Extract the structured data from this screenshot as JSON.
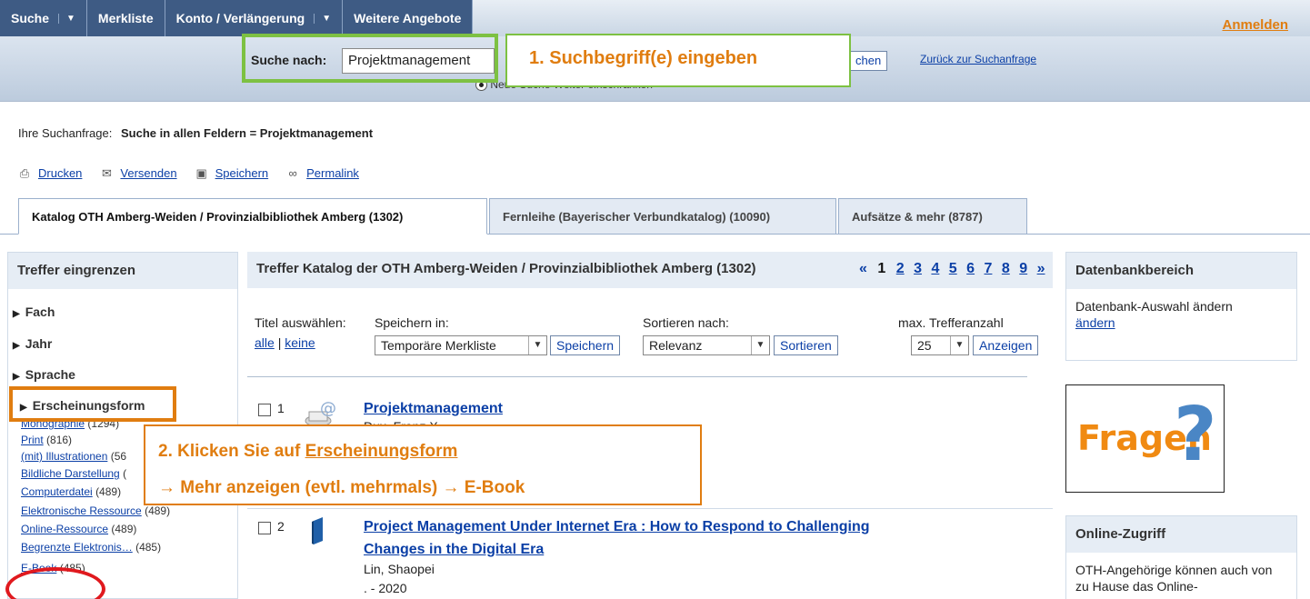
{
  "nav": {
    "items": [
      "Suche",
      "Merkliste",
      "Konto / Verlängerung",
      "Weitere Angebote"
    ],
    "login": "Anmelden"
  },
  "search": {
    "label": "Suche nach:",
    "value": "Projektmanagement",
    "button": "chen",
    "back_link": "Zurück zur Suchanfrage",
    "radio_label": "Neue Suche  Weiter einschränken"
  },
  "callout1": "1. Suchbegriff(e) eingeben",
  "query": {
    "label": "Ihre Suchanfrage:",
    "value": "Suche in allen Feldern = Projektmanagement"
  },
  "tools": [
    "Drucken",
    "Versenden",
    "Speichern",
    "Permalink"
  ],
  "tabs": [
    {
      "label": "Katalog OTH Amberg-Weiden / Provinzialbibliothek Amberg (1302)"
    },
    {
      "label": "Fernleihe (Bayerischer Verbundkatalog) (10090)"
    },
    {
      "label": "Aufsätze & mehr (8787)"
    }
  ],
  "facets": {
    "title": "Treffer eingrenzen",
    "items": [
      "Fach",
      "Jahr",
      "Sprache",
      "Erscheinungsform"
    ],
    "sub": [
      {
        "label": "Monographie",
        "count": "(1294)"
      },
      {
        "label": "Print",
        "count": "(816)"
      },
      {
        "label": "(mit) Illustrationen",
        "count": "(56"
      },
      {
        "label": "Bildliche Darstellung",
        "count": "("
      },
      {
        "label": "Computerdatei",
        "count": "(489)"
      },
      {
        "label": "Elektronische Ressource",
        "count": "(489)"
      },
      {
        "label": "Online-Ressource",
        "count": "(489)"
      },
      {
        "label": "Begrenzte Elektronis…",
        "count": "(485)"
      },
      {
        "label": "E-Book",
        "count": "(485)"
      }
    ]
  },
  "callout2": {
    "prefix": "2. Klicken Sie auf ",
    "link": "Erscheinungsform",
    "line2": "→ Mehr anzeigen (evtl. mehrmals) → E-Book"
  },
  "results": {
    "heading": "Treffer Katalog der OTH Amberg-Weiden / Provinzialbibliothek Amberg (1302)",
    "pager": {
      "prev": "«",
      "current": "1",
      "pages": [
        "2",
        "3",
        "4",
        "5",
        "6",
        "7",
        "8",
        "9"
      ],
      "next": "»"
    },
    "select_label": "Titel auswählen:",
    "all": "alle",
    "none": "keine",
    "save_in_label": "Speichern in:",
    "save_in_value": "Temporäre Merkliste",
    "save_button": "Speichern",
    "sort_label": "Sortieren nach:",
    "sort_value": "Relevanz",
    "sort_button": "Sortieren",
    "max_label": "max. Trefferanzahl",
    "max_value": "25",
    "show_button": "Anzeigen",
    "items": [
      {
        "num": "1",
        "title": "Projektmanagement",
        "author": "Dux, Franz X."
      },
      {
        "num": "2",
        "title": "Project Management Under Internet Era : How to Respond to Challenging",
        "title2": "Changes in the Digital Era",
        "author": "Lin, Shaopei",
        "year": ". - 2020"
      }
    ]
  },
  "sidebar": {
    "db_title": "Datenbankbereich",
    "db_text": "Datenbank-Auswahl ändern",
    "db_link": "ändern",
    "fragen": "Fragen",
    "fragen_q": "?",
    "online_title": "Online-Zugriff",
    "online_text": "OTH-Angehörige können auch von zu Hause das Online-"
  }
}
